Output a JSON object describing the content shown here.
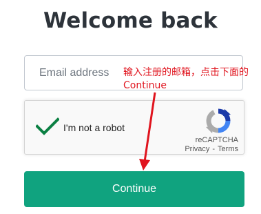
{
  "heading": "Welcome back",
  "email": {
    "placeholder": "Email address",
    "value": ""
  },
  "recaptcha": {
    "label": "I'm not a robot",
    "brand": "reCAPTCHA",
    "privacy": "Privacy",
    "separator": "-",
    "terms": "Terms",
    "checked": true
  },
  "continue_button": {
    "label": "Continue"
  },
  "annotation": {
    "line1": "输入注册的邮箱，点击下面的",
    "line2": "Continue"
  },
  "colors": {
    "accent": "#10a37f",
    "annotation": "#e0141e",
    "check": "#0b8043"
  },
  "icons": {
    "check": "checkmark-icon",
    "recaptcha_logo": "recaptcha-logo-icon",
    "arrow": "arrow-down-icon"
  }
}
